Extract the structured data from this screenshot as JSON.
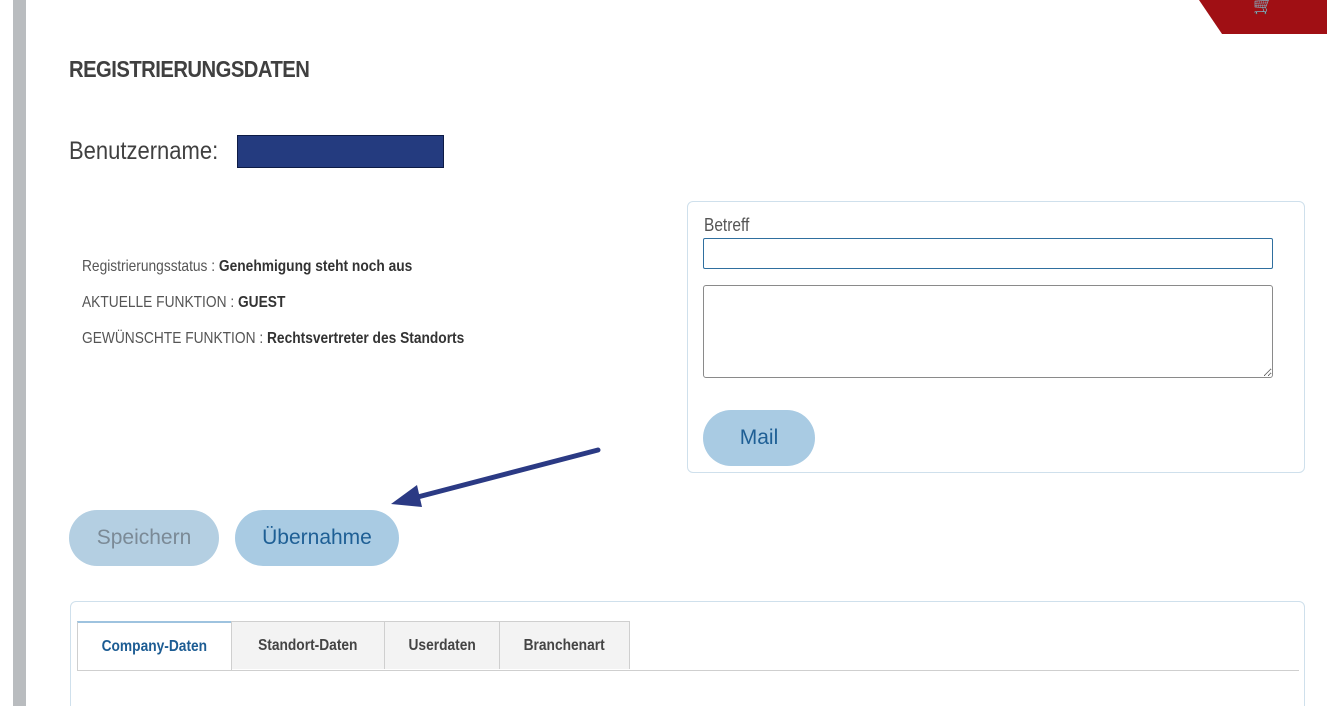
{
  "header": {
    "cart_icon": "shopping-cart-icon",
    "cart_color": "#a00f14"
  },
  "section": {
    "title": "REGISTRIERUNGSDATEN"
  },
  "user": {
    "username_label": "Benutzername:",
    "username_value": ""
  },
  "status": {
    "registration_label": "Registrierungsstatus : ",
    "registration_value": "Genehmigung steht noch aus",
    "current_function_label": "AKTUELLE FUNKTION : ",
    "current_function_value": "GUEST",
    "desired_function_label": "GEWÜNSCHTE FUNKTION : ",
    "desired_function_value": "Rechtsvertreter des Standorts"
  },
  "mail_form": {
    "subject_label": "Betreff",
    "subject_value": "",
    "message_value": "",
    "send_label": "Mail"
  },
  "actions": {
    "save_label": "Speichern",
    "takeover_label": "Übernahme"
  },
  "annotation": {
    "arrow_color": "#2b3a84",
    "target": "Übernahme"
  },
  "tabs": [
    {
      "label": "Company-Daten",
      "active": true
    },
    {
      "label": "Standort-Daten",
      "active": false
    },
    {
      "label": "Userdaten",
      "active": false
    },
    {
      "label": "Branchenart",
      "active": false
    }
  ],
  "colors": {
    "button_fill": "#a9cbe3",
    "button_text": "#1e5f95",
    "active_tab_text": "#1c5c93"
  }
}
